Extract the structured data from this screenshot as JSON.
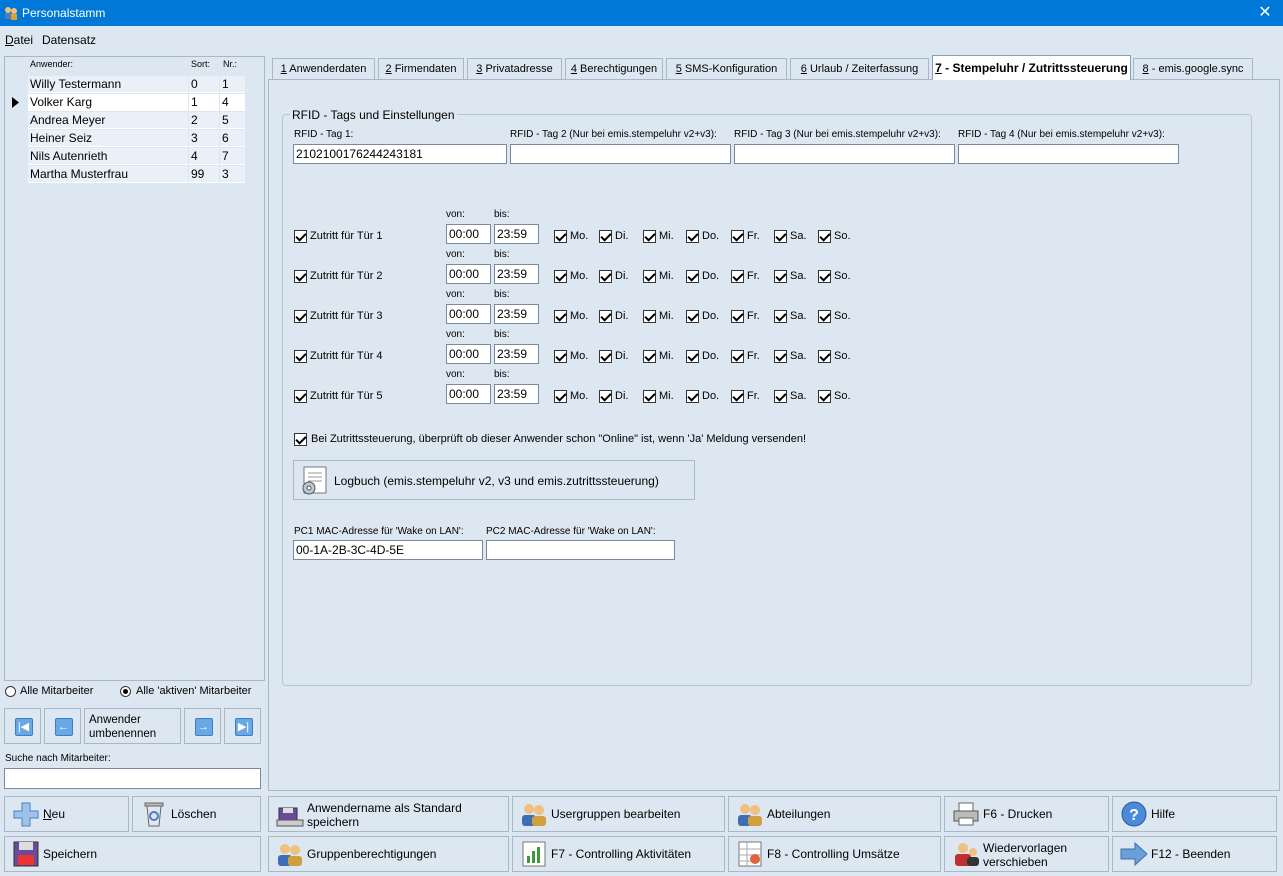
{
  "window": {
    "title": "Personalstamm",
    "close": "✕"
  },
  "menu": [
    "Datei",
    "Datensatz"
  ],
  "grid": {
    "headers": {
      "name": "Anwender:",
      "sort": "Sort:",
      "nr": "Nr.:"
    },
    "rows": [
      {
        "name": "Willy Testermann",
        "sort": "0",
        "nr": "1"
      },
      {
        "name": "Volker Karg",
        "sort": "1",
        "nr": "4"
      },
      {
        "name": "Andrea Meyer",
        "sort": "2",
        "nr": "5"
      },
      {
        "name": "Heiner Seiz",
        "sort": "3",
        "nr": "6"
      },
      {
        "name": "Nils Autenrieth",
        "sort": "4",
        "nr": "7"
      },
      {
        "name": "Martha Musterfrau",
        "sort": "99",
        "nr": "3"
      }
    ],
    "selected_index": 1
  },
  "filter": {
    "all": "Alle Mitarbeiter",
    "active": "Alle 'aktiven' Mitarbeiter",
    "selected": "active"
  },
  "nav": {
    "rename_line1": "Anwender",
    "rename_line2": "umbenennen"
  },
  "search": {
    "label": "Suche nach Mitarbeiter:",
    "value": ""
  },
  "tabs": [
    {
      "key": "1",
      "label": " Anwenderdaten"
    },
    {
      "key": "2",
      "label": " Firmendaten"
    },
    {
      "key": "3",
      "label": " Privatadresse"
    },
    {
      "key": "4",
      "label": " Berechtigungen"
    },
    {
      "key": "5",
      "label": " SMS-Konfiguration"
    },
    {
      "key": "6",
      "label": " Urlaub / Zeiterfassung"
    },
    {
      "key": "7",
      "label": " - Stempeluhr / Zutrittssteuerung"
    },
    {
      "key": "8",
      "label": " - emis.google.sync"
    }
  ],
  "rfid": {
    "group_title": "RFID - Tags und Einstellungen",
    "tag1_label": "RFID - Tag 1:",
    "tag2_label": "RFID - Tag 2 (Nur bei emis.stempeluhr v2+v3):",
    "tag3_label": "RFID - Tag 3 (Nur bei emis.stempeluhr v2+v3):",
    "tag4_label": "RFID - Tag 4 (Nur bei emis.stempeluhr v2+v3):",
    "tag1_value": "2102100176244243181",
    "tag2_value": "",
    "tag3_value": "",
    "tag4_value": ""
  },
  "access": {
    "from_label": "von:",
    "to_label": "bis:",
    "days": [
      "Mo.",
      "Di.",
      "Mi.",
      "Do.",
      "Fr.",
      "Sa.",
      "So."
    ],
    "doors": [
      {
        "label": "Zutritt für Tür 1",
        "from": "00:00",
        "to": "23:59"
      },
      {
        "label": "Zutritt für Tür 2",
        "from": "00:00",
        "to": "23:59"
      },
      {
        "label": "Zutritt für Tür 3",
        "from": "00:00",
        "to": "23:59"
      },
      {
        "label": "Zutritt für Tür 4",
        "from": "00:00",
        "to": "23:59"
      },
      {
        "label": "Zutritt für Tür 5",
        "from": "00:00",
        "to": "23:59"
      }
    ]
  },
  "online_check": "Bei Zutrittssteuerung, überprüft ob dieser Anwender schon \"Online\" ist, wenn 'Ja' Meldung versenden!",
  "logbuch": "Logbuch (emis.stempeluhr v2, v3 und emis.zutrittssteuerung)",
  "mac": {
    "pc1_label": "PC1 MAC-Adresse für 'Wake on LAN':",
    "pc2_label": "PC2 MAC-Adresse für 'Wake on LAN':",
    "pc1_value": "00-1A-2B-3C-4D-5E",
    "pc2_value": ""
  },
  "buttons": {
    "neu": "Neu",
    "loeschen": "Löschen",
    "standard_line1": "Anwendername als Standard",
    "standard_line2": "speichern",
    "usergruppen": "Usergruppen bearbeiten",
    "abteilungen": "Abteilungen",
    "drucken": "F6 - Drucken",
    "hilfe": "Hilfe",
    "speichern": "Speichern",
    "gruppenrechte": "Gruppenberechtigungen",
    "aktivitaeten": "F7 - Controlling Aktivitäten",
    "umsaetze": "F8 - Controlling Umsätze",
    "wiedervorlagen_line1": "Wiedervorlagen",
    "wiedervorlagen_line2": "verschieben",
    "beenden": "F12 - Beenden"
  },
  "colors": {
    "titlebar": "#0078d7",
    "window_bg": "#dde7f1"
  }
}
